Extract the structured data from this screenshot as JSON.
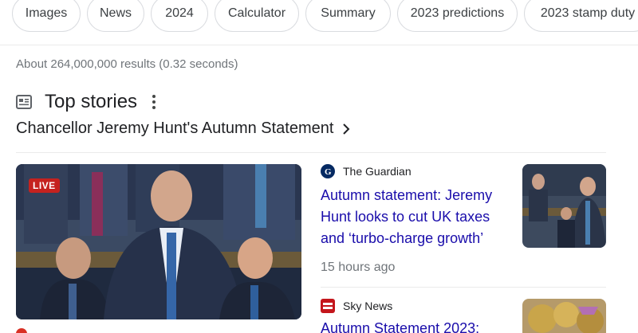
{
  "chips": [
    {
      "label": "Images"
    },
    {
      "label": "News"
    },
    {
      "label": "2024"
    },
    {
      "label": "Calculator"
    },
    {
      "label": "Summary"
    },
    {
      "label": "2023 predictions"
    },
    {
      "label": "2023 stamp duty"
    }
  ],
  "result_stats": "About 264,000,000 results (0.32 seconds)",
  "top_stories": {
    "title": "Top stories",
    "icon": "news-icon",
    "more_icon": "more-vert-icon"
  },
  "topic": {
    "label": "Chancellor Jeremy Hunt's Autumn Statement",
    "icon": "chevron-right-icon"
  },
  "main_story": {
    "badge": "LIVE"
  },
  "stories": [
    {
      "source": "The Guardian",
      "title_lines": [
        "Autumn statement: Jeremy",
        "Hunt looks to cut UK taxes",
        "and ‘turbo-charge growth’"
      ],
      "time": "15 hours ago"
    },
    {
      "source": "Sky News",
      "title_lines": [
        "Autumn Statement 2023:"
      ]
    }
  ],
  "colors": {
    "link": "#1a0dab",
    "live": "#c5221f",
    "meta": "#70757a"
  }
}
